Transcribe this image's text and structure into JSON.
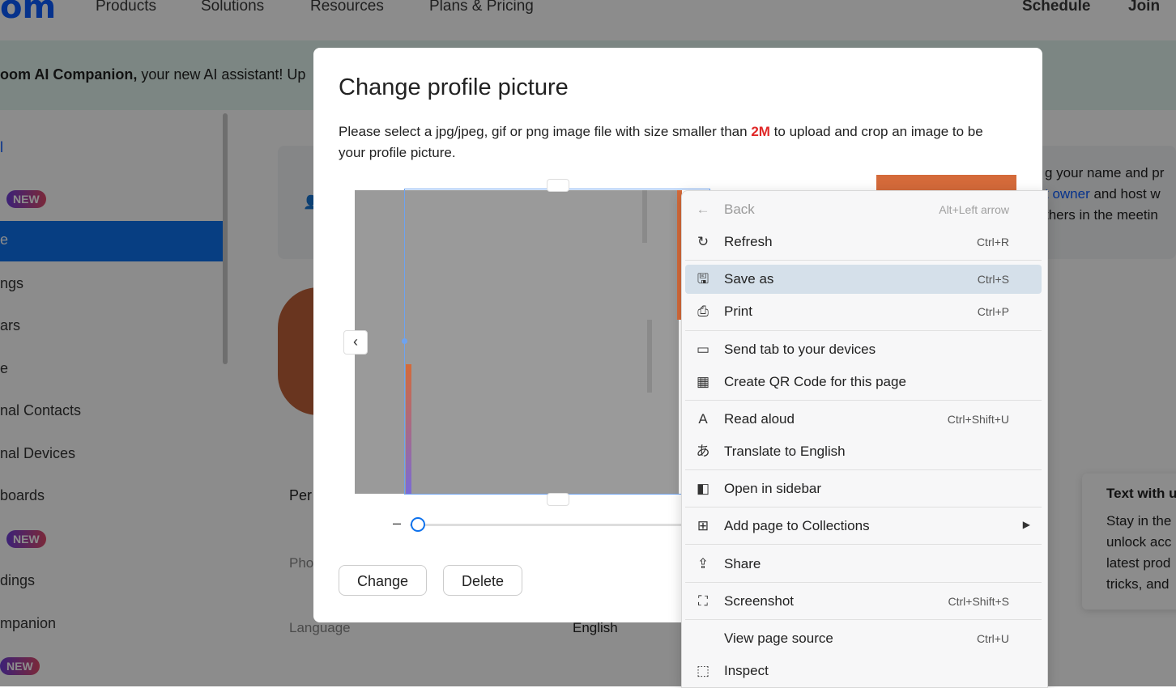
{
  "nav": {
    "logo": "om",
    "links": [
      "Products",
      "Solutions",
      "Resources",
      "Plans & Pricing"
    ],
    "schedule": "Schedule",
    "join": "Join"
  },
  "banner": {
    "bold": "oom AI Companion,",
    "text": " your new AI assistant! Up"
  },
  "sidebar": {
    "items": [
      "l",
      "",
      "e",
      "ngs",
      "ars",
      "e",
      "nal Contacts",
      "nal Devices",
      "boards",
      "",
      "dings",
      "mpanion",
      ""
    ],
    "badge": "NEW"
  },
  "background": {
    "card_text_1": "g your name and pr",
    "card_link": "t owner",
    "card_text_2": " and host w",
    "card_text_3": "thers in the meetin",
    "per_label": "Per",
    "pho_label": "Pho",
    "language_label": "Language",
    "language_value": "English",
    "tip_title": "Text with u",
    "tip_lines": [
      "Stay in the",
      "unlock acc",
      "latest prod",
      "tricks, and"
    ]
  },
  "dialog": {
    "title": "Change profile picture",
    "desc_pre": "Please select a jpg/jpeg, gif or png image file with size smaller than ",
    "desc_highlight": "2M",
    "desc_post": " to upload and crop an image to be your profile picture.",
    "slider_minus": "–",
    "slider_value": 0,
    "change_button": "Change",
    "delete_button": "Delete"
  },
  "context_menu": {
    "items": [
      {
        "icon": "back-arrow-icon",
        "glyph": "←",
        "label": "Back",
        "shortcut": "Alt+Left arrow",
        "disabled": true
      },
      {
        "icon": "refresh-icon",
        "glyph": "↻",
        "label": "Refresh",
        "shortcut": "Ctrl+R"
      },
      {
        "icon": "save-as-icon",
        "glyph": "🖫",
        "label": "Save as",
        "shortcut": "Ctrl+S",
        "active": true
      },
      {
        "icon": "print-icon",
        "glyph": "⎙",
        "label": "Print",
        "shortcut": "Ctrl+P"
      },
      {
        "icon": "send-tab-icon",
        "glyph": "▭",
        "label": "Send tab to your devices",
        "shortcut": ""
      },
      {
        "icon": "qr-code-icon",
        "glyph": "▦",
        "label": "Create QR Code for this page",
        "shortcut": ""
      },
      {
        "icon": "read-aloud-icon",
        "glyph": "A",
        "label": "Read aloud",
        "shortcut": "Ctrl+Shift+U"
      },
      {
        "icon": "translate-icon",
        "glyph": "あ",
        "label": "Translate to English",
        "shortcut": ""
      },
      {
        "icon": "sidebar-icon",
        "glyph": "◧",
        "label": "Open in sidebar",
        "shortcut": ""
      },
      {
        "icon": "collections-icon",
        "glyph": "⊞",
        "label": "Add page to Collections",
        "shortcut": "",
        "submenu": true
      },
      {
        "icon": "share-icon",
        "glyph": "⇪",
        "label": "Share",
        "shortcut": ""
      },
      {
        "icon": "screenshot-icon",
        "glyph": "⛶",
        "label": "Screenshot",
        "shortcut": "Ctrl+Shift+S"
      },
      {
        "icon": "",
        "glyph": "",
        "label": "View page source",
        "shortcut": "Ctrl+U"
      },
      {
        "icon": "inspect-icon",
        "glyph": "⬚",
        "label": "Inspect",
        "shortcut": ""
      }
    ]
  }
}
